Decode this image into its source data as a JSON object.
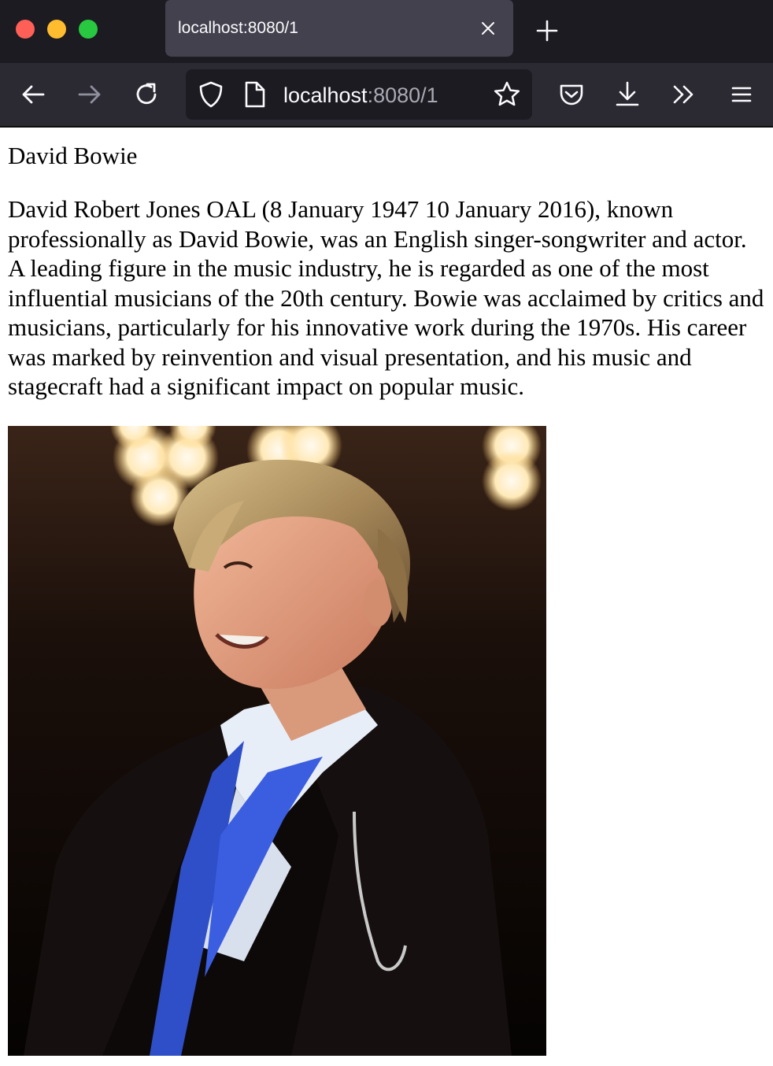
{
  "browser": {
    "tab_title": "localhost:8080/1",
    "url_host": "localhost",
    "url_rest": ":8080/1",
    "icons": {
      "close": "close-icon",
      "new_tab": "plus-icon",
      "back": "back-arrow-icon",
      "forward": "forward-arrow-icon",
      "reload": "reload-icon",
      "shield": "shield-icon",
      "page": "page-icon",
      "star": "star-icon",
      "pocket": "pocket-icon",
      "download": "download-icon",
      "overflow": "chevrons-right-icon",
      "menu": "hamburger-menu-icon"
    },
    "colors": {
      "tabbar": "#1c1b22",
      "navbar": "#2b2a33",
      "active_tab": "#42414d"
    }
  },
  "page": {
    "heading": "David Bowie",
    "paragraph": "David Robert Jones OAL (8 January 1947 10 January 2016), known professionally as David Bowie, was an English singer-songwriter and actor. A leading figure in the music industry, he is regarded as one of the most influential musicians of the 20th century. Bowie was acclaimed by critics and musicians, particularly for his innovative work during the 1970s. His career was marked by reinvention and visual presentation, and his music and stagecraft had a significant impact on popular music."
  }
}
